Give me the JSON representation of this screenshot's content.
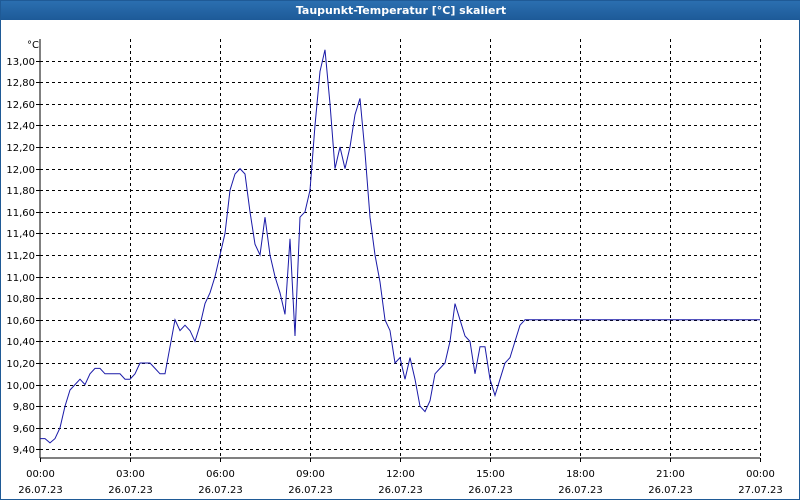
{
  "window": {
    "title": "Taupunkt-Temperatur [°C] skaliert"
  },
  "chart_data": {
    "type": "line",
    "title": "Taupunkt-Temperatur [°C] skaliert",
    "ylabel": "°C",
    "xlabel": "",
    "ylim": [
      9.32,
      13.2
    ],
    "xlim_hours": [
      0,
      24
    ],
    "grid": true,
    "colors": {
      "line": "#1a1aa8",
      "grid": "#000000"
    },
    "yticks": [
      9.4,
      9.6,
      9.8,
      10.0,
      10.2,
      10.4,
      10.6,
      10.8,
      11.0,
      11.2,
      11.4,
      11.6,
      11.8,
      12.0,
      12.2,
      12.4,
      12.6,
      12.8,
      13.0
    ],
    "ytick_labels": [
      "9,40",
      "9,60",
      "9,80",
      "10,00",
      "10,20",
      "10,40",
      "10,60",
      "10,80",
      "11,00",
      "11,20",
      "11,40",
      "11,60",
      "11,80",
      "12,00",
      "12,20",
      "12,40",
      "12,60",
      "12,80",
      "13,00"
    ],
    "xticks": [
      {
        "time": "00:00",
        "date": "26.07.23"
      },
      {
        "time": "03:00",
        "date": "26.07.23"
      },
      {
        "time": "06:00",
        "date": "26.07.23"
      },
      {
        "time": "09:00",
        "date": "26.07.23"
      },
      {
        "time": "12:00",
        "date": "26.07.23"
      },
      {
        "time": "15:00",
        "date": "26.07.23"
      },
      {
        "time": "18:00",
        "date": "26.07.23"
      },
      {
        "time": "21:00",
        "date": "26.07.23"
      },
      {
        "time": "00:00",
        "date": "27.07.23"
      }
    ],
    "series": [
      {
        "x": [
          "26.07.23 00:00",
          "26.07.23 00:10",
          "26.07.23 00:20",
          "26.07.23 00:30",
          "26.07.23 00:40",
          "26.07.23 00:50",
          "26.07.23 01:00",
          "26.07.23 01:10",
          "26.07.23 01:20",
          "26.07.23 01:30",
          "26.07.23 01:40",
          "26.07.23 01:50",
          "26.07.23 02:00",
          "26.07.23 02:10",
          "26.07.23 02:20",
          "26.07.23 02:30",
          "26.07.23 02:40",
          "26.07.23 02:50",
          "26.07.23 03:00",
          "26.07.23 03:10",
          "26.07.23 03:20",
          "26.07.23 03:30",
          "26.07.23 03:40",
          "26.07.23 03:50",
          "26.07.23 04:00",
          "26.07.23 04:10",
          "26.07.23 04:20",
          "26.07.23 04:30",
          "26.07.23 04:40",
          "26.07.23 04:50",
          "26.07.23 05:00",
          "26.07.23 05:10",
          "26.07.23 05:20",
          "26.07.23 05:30",
          "26.07.23 05:40",
          "26.07.23 05:50",
          "26.07.23 06:00",
          "26.07.23 06:10",
          "26.07.23 06:20",
          "26.07.23 06:30",
          "26.07.23 06:40",
          "26.07.23 06:50",
          "26.07.23 07:00",
          "26.07.23 07:10",
          "26.07.23 07:20",
          "26.07.23 07:30",
          "26.07.23 07:40",
          "26.07.23 07:50",
          "26.07.23 08:00",
          "26.07.23 08:10",
          "26.07.23 08:20",
          "26.07.23 08:30",
          "26.07.23 08:40",
          "26.07.23 08:50",
          "26.07.23 09:00",
          "26.07.23 09:10",
          "26.07.23 09:20",
          "26.07.23 09:30",
          "26.07.23 09:40",
          "26.07.23 09:50",
          "26.07.23 10:00",
          "26.07.23 10:10",
          "26.07.23 10:20",
          "26.07.23 10:30",
          "26.07.23 10:40",
          "26.07.23 10:50",
          "26.07.23 11:00",
          "26.07.23 11:10",
          "26.07.23 11:20",
          "26.07.23 11:30",
          "26.07.23 11:40",
          "26.07.23 11:50",
          "26.07.23 12:00",
          "26.07.23 12:10",
          "26.07.23 12:20",
          "26.07.23 12:30",
          "26.07.23 12:40",
          "26.07.23 12:50",
          "26.07.23 13:00",
          "26.07.23 13:10",
          "26.07.23 13:20",
          "26.07.23 13:30",
          "26.07.23 13:40",
          "26.07.23 13:50",
          "26.07.23 14:00",
          "26.07.23 14:10",
          "26.07.23 14:20",
          "26.07.23 14:30",
          "26.07.23 14:40",
          "26.07.23 14:50",
          "26.07.23 15:00",
          "26.07.23 15:10",
          "26.07.23 15:20",
          "26.07.23 15:30",
          "26.07.23 15:40",
          "26.07.23 15:50",
          "26.07.23 16:00",
          "26.07.23 16:10",
          "26.07.23 16:20",
          "26.07.23 16:30",
          "26.07.23 16:40",
          "26.07.23 16:50",
          "26.07.23 17:00",
          "26.07.23 17:10",
          "26.07.23 17:20",
          "26.07.23 17:30",
          "26.07.23 17:40",
          "26.07.23 17:50",
          "26.07.23 18:00",
          "26.07.23 18:10",
          "26.07.23 18:20",
          "26.07.23 18:30",
          "26.07.23 18:40",
          "26.07.23 18:50",
          "26.07.23 19:00",
          "26.07.23 19:10",
          "26.07.23 19:20",
          "26.07.23 19:30",
          "26.07.23 19:40",
          "26.07.23 19:50",
          "26.07.23 20:00",
          "26.07.23 20:10",
          "26.07.23 20:20",
          "26.07.23 20:30",
          "26.07.23 20:40",
          "26.07.23 20:50",
          "26.07.23 21:00",
          "26.07.23 21:10",
          "26.07.23 21:20",
          "26.07.23 21:30",
          "26.07.23 21:40",
          "26.07.23 21:50",
          "26.07.23 22:00",
          "26.07.23 22:10",
          "26.07.23 22:20",
          "26.07.23 22:30",
          "26.07.23 22:40",
          "26.07.23 22:50",
          "26.07.23 23:00",
          "26.07.23 23:10",
          "26.07.23 23:20",
          "26.07.23 23:30",
          "26.07.23 23:40",
          "26.07.23 23:50",
          "27.07.23 00:00"
        ],
        "values": [
          9.5,
          9.5,
          9.46,
          9.5,
          9.6,
          9.8,
          9.95,
          10.0,
          10.05,
          10.0,
          10.1,
          10.15,
          10.15,
          10.1,
          10.1,
          10.1,
          10.1,
          10.05,
          10.05,
          10.1,
          10.2,
          10.2,
          10.2,
          10.15,
          10.1,
          10.1,
          10.35,
          10.6,
          10.5,
          10.55,
          10.5,
          10.4,
          10.55,
          10.75,
          10.85,
          11.0,
          11.2,
          11.4,
          11.8,
          11.95,
          12.0,
          11.95,
          11.6,
          11.3,
          11.2,
          11.55,
          11.2,
          11.0,
          10.85,
          10.65,
          11.35,
          10.45,
          11.55,
          11.6,
          11.8,
          12.4,
          12.9,
          13.1,
          12.6,
          12.0,
          12.2,
          12.0,
          12.2,
          12.5,
          12.65,
          12.15,
          11.55,
          11.2,
          10.95,
          10.6,
          10.5,
          10.2,
          10.25,
          10.05,
          10.25,
          10.05,
          9.8,
          9.75,
          9.85,
          10.1,
          10.15,
          10.2,
          10.4,
          10.75,
          10.6,
          10.45,
          10.4,
          10.1,
          10.35,
          10.35,
          10.05,
          9.9,
          10.05,
          10.2,
          10.25,
          10.4,
          10.55,
          10.6,
          10.6,
          10.6,
          10.6,
          10.6,
          10.6,
          10.6,
          10.6,
          10.6,
          10.6,
          10.6,
          10.6,
          10.6,
          10.6,
          10.6,
          10.6,
          10.6,
          10.6,
          10.6,
          10.6,
          10.6,
          10.6,
          10.6,
          10.6,
          10.6,
          10.6,
          10.6,
          10.6,
          10.6,
          10.6,
          10.6,
          10.6,
          10.6,
          10.6,
          10.6,
          10.6,
          10.6,
          10.6,
          10.6,
          10.6,
          10.6,
          10.6,
          10.6,
          10.6,
          10.6,
          10.6,
          10.6,
          10.6
        ]
      }
    ]
  }
}
